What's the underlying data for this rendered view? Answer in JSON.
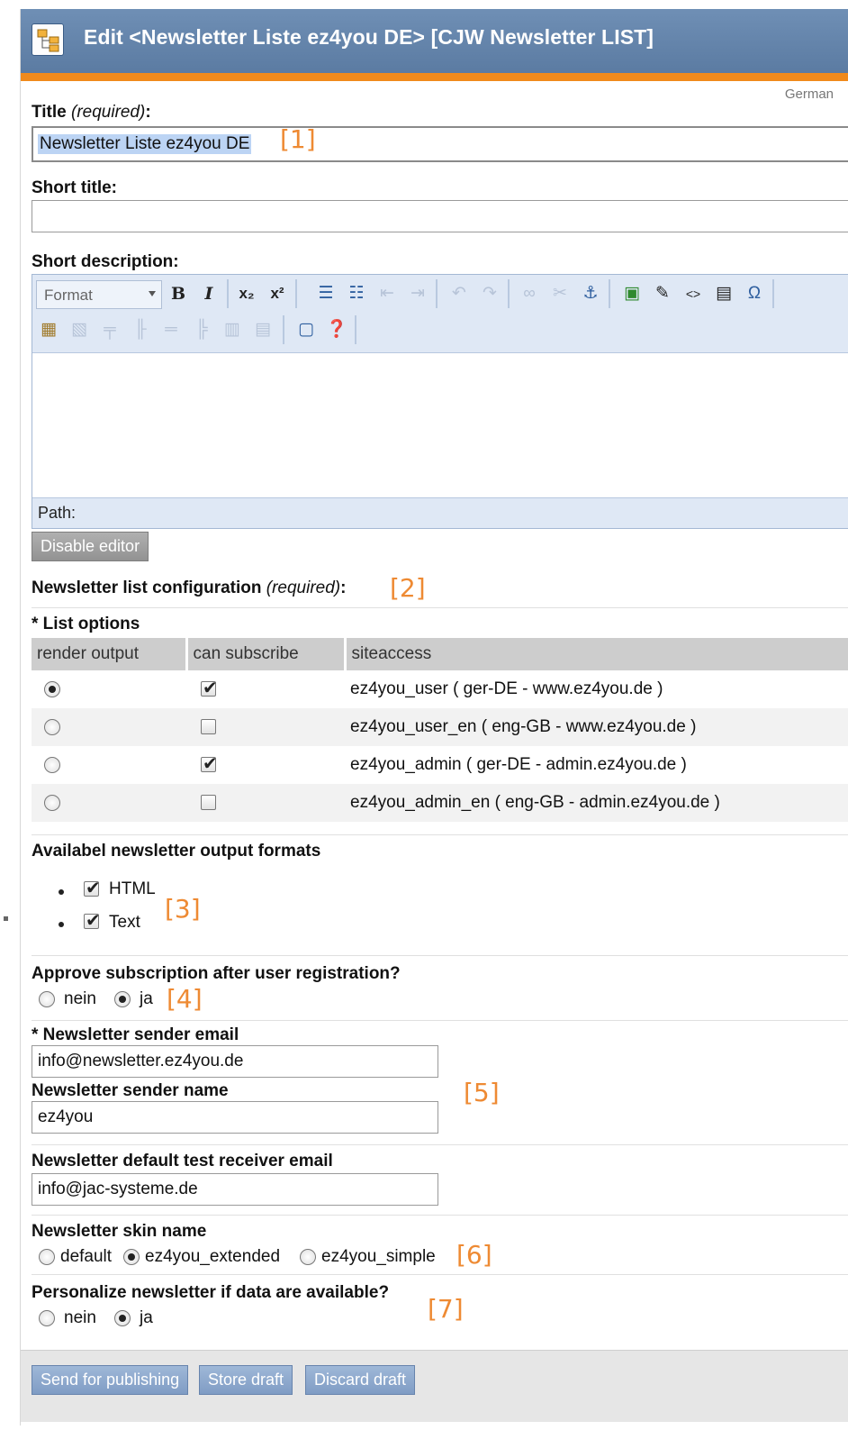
{
  "header": {
    "title": "Edit <Newsletter Liste ez4you DE> [CJW Newsletter LIST]",
    "language": "German"
  },
  "title_field": {
    "label": "Title",
    "required": "(required)",
    "colon": ":",
    "value": "Newsletter Liste ez4you DE",
    "annotation": "[1]"
  },
  "short_title": {
    "label": "Short title:",
    "value": ""
  },
  "short_description": {
    "label": "Short description:",
    "format_select": "Format",
    "path_label": "Path:",
    "disable_button": "Disable editor"
  },
  "list_config": {
    "label": "Newsletter list configuration",
    "required": "(required)",
    "colon": ":",
    "annotation": "[2]"
  },
  "list_options": {
    "label": "* List options",
    "columns": [
      "render output",
      "can subscribe",
      "siteaccess"
    ],
    "rows": [
      {
        "render_output": true,
        "can_subscribe": true,
        "siteaccess": "ez4you_user ( ger-DE - www.ez4you.de )"
      },
      {
        "render_output": false,
        "can_subscribe": false,
        "siteaccess": "ez4you_user_en ( eng-GB - www.ez4you.de )"
      },
      {
        "render_output": false,
        "can_subscribe": true,
        "siteaccess": "ez4you_admin ( ger-DE - admin.ez4you.de )"
      },
      {
        "render_output": false,
        "can_subscribe": false,
        "siteaccess": "ez4you_admin_en ( eng-GB - admin.ez4you.de )"
      }
    ]
  },
  "output_formats": {
    "label": "Availabel newsletter output formats",
    "items": [
      {
        "label": "HTML",
        "checked": true
      },
      {
        "label": "Text",
        "checked": true
      }
    ],
    "annotation": "[3]"
  },
  "approve": {
    "label": "Approve subscription after user registration?",
    "options": [
      {
        "label": "nein",
        "selected": false
      },
      {
        "label": "ja",
        "selected": true
      }
    ],
    "annotation": "[4]"
  },
  "sender": {
    "email_label": "* Newsletter sender email",
    "email_value": "info@newsletter.ez4you.de",
    "name_label": "Newsletter sender name",
    "name_value": "ez4you",
    "annotation": "[5]"
  },
  "test_receiver": {
    "label": "Newsletter default test receiver email",
    "value": "info@jac-systeme.de"
  },
  "skin": {
    "label": "Newsletter skin name",
    "options": [
      {
        "label": "default",
        "selected": false
      },
      {
        "label": "ez4you_extended",
        "selected": true
      },
      {
        "label": "ez4you_simple",
        "selected": false
      }
    ],
    "annotation": "[6]"
  },
  "personalize": {
    "label": "Personalize newsletter if data are available?",
    "options": [
      {
        "label": "nein",
        "selected": false
      },
      {
        "label": "ja",
        "selected": true
      }
    ],
    "annotation": "[7]"
  },
  "footer": {
    "send": "Send for publishing",
    "store": "Store draft",
    "discard": "Discard draft"
  }
}
